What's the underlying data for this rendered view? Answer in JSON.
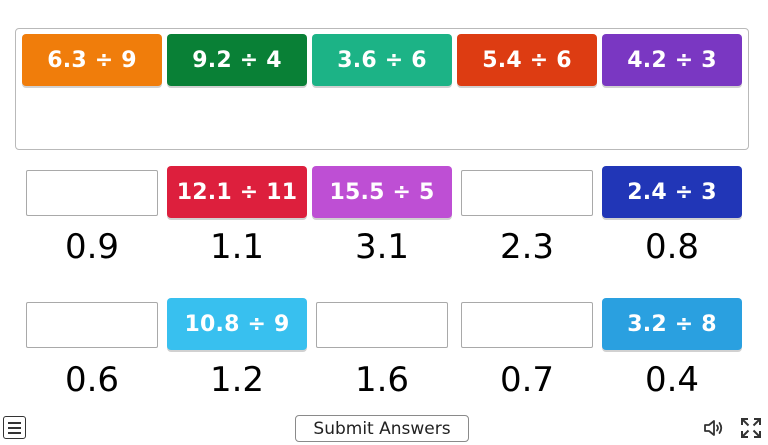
{
  "tray_tiles": [
    {
      "label": "6.3 ÷ 9",
      "color": "#f07d0b"
    },
    {
      "label": "9.2 ÷ 4",
      "color": "#098036"
    },
    {
      "label": "3.6 ÷ 6",
      "color": "#1cb386"
    },
    {
      "label": "5.4 ÷ 6",
      "color": "#dd3c12"
    },
    {
      "label": "4.2 ÷ 3",
      "color": "#7a37c2"
    }
  ],
  "targets": [
    {
      "label": "0.9",
      "placed": null
    },
    {
      "label": "1.1",
      "placed": {
        "label": "12.1 ÷ 11",
        "color": "#dd1f3d"
      }
    },
    {
      "label": "3.1",
      "placed": {
        "label": "15.5 ÷ 5",
        "color": "#be4fd4"
      }
    },
    {
      "label": "2.3",
      "placed": null
    },
    {
      "label": "0.8",
      "placed": {
        "label": "2.4 ÷ 3",
        "color": "#2136b7"
      }
    },
    {
      "label": "0.6",
      "placed": null
    },
    {
      "label": "1.2",
      "placed": {
        "label": "10.8 ÷ 9",
        "color": "#38c0ef"
      }
    },
    {
      "label": "1.6",
      "placed": null
    },
    {
      "label": "0.7",
      "placed": null
    },
    {
      "label": "0.4",
      "placed": {
        "label": "3.2 ÷ 8",
        "color": "#2aa0e0"
      }
    }
  ],
  "footer": {
    "submit_label": "Submit Answers",
    "menu_icon": "menu-icon",
    "sound_icon": "speaker-icon",
    "fullscreen_icon": "fullscreen-icon"
  }
}
